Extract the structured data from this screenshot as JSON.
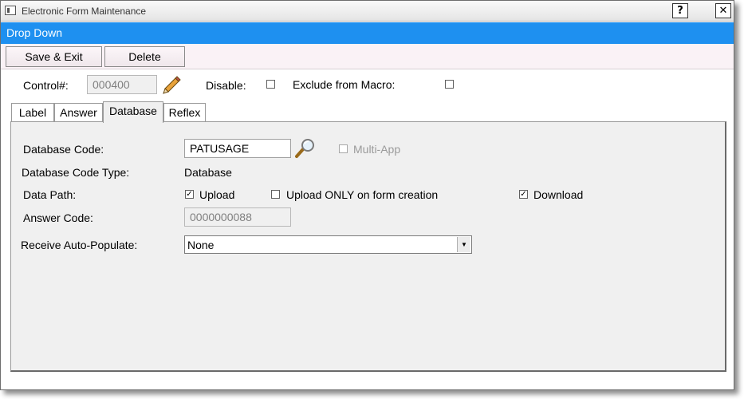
{
  "window": {
    "title": "Electronic Form Maintenance",
    "help_label": "?",
    "close_label": "✕"
  },
  "header": {
    "title": "Drop Down"
  },
  "toolbar": {
    "save_exit_label": "Save & Exit",
    "delete_label": "Delete"
  },
  "control": {
    "label": "Control#:",
    "value": "000400",
    "disable_label": "Disable:",
    "disable_checked": false,
    "exclude_macro_label": "Exclude from Macro:",
    "exclude_macro_checked": false
  },
  "tabs": [
    {
      "label": "Label"
    },
    {
      "label": "Answer"
    },
    {
      "label": "Database",
      "active": true
    },
    {
      "label": "Reflex"
    }
  ],
  "database": {
    "code_label": "Database Code:",
    "code_value": "PATUSAGE",
    "multi_app_label": "Multi-App",
    "multi_app_checked": false,
    "code_type_label": "Database Code Type:",
    "code_type_value": "Database",
    "data_path_label": "Data Path:",
    "upload_label": "Upload",
    "upload_checked": true,
    "upload_only_label": "Upload ONLY on form creation",
    "upload_only_checked": false,
    "download_label": "Download",
    "download_checked": true,
    "answer_code_label": "Answer Code:",
    "answer_code_value": "0000000088",
    "auto_populate_label": "Receive Auto-Populate:",
    "auto_populate_value": "None"
  },
  "check_glyph": "✓",
  "icons": {
    "edit": "pencil-icon",
    "lookup": "magnifier-icon",
    "app": "window-icon",
    "dropdown": "chevron-down-icon"
  },
  "colors": {
    "header_band": "#1e90f0",
    "toolbar_bg": "#faf2f6",
    "panel_bg": "#f0f0f0"
  }
}
